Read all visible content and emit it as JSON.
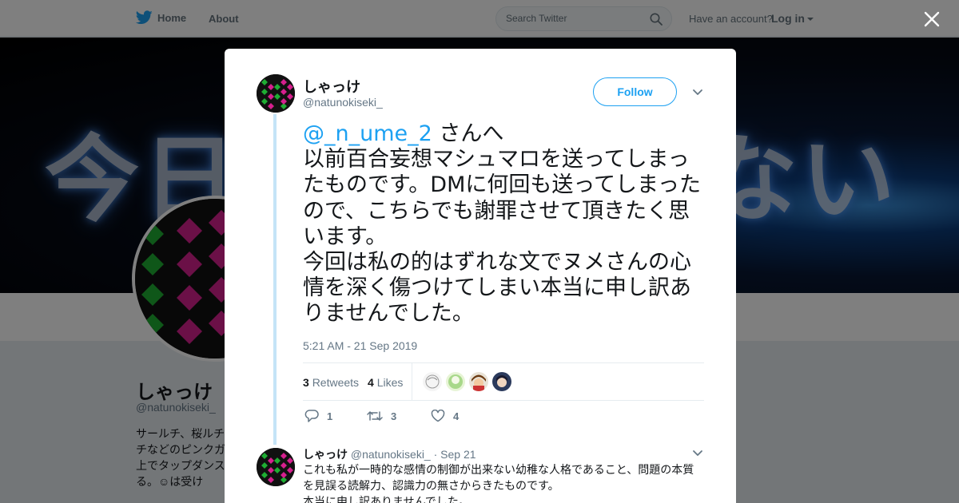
{
  "nav": {
    "home_label": "Home",
    "about_label": "About",
    "search_placeholder": "Search Twitter",
    "account_prompt": "Have an account?",
    "login_label": "Log in"
  },
  "banner": {
    "text_left": "今日",
    "text_right": "ない"
  },
  "profile": {
    "name": "しゃっけ",
    "handle": "@natunokiseki_",
    "bio": "サールチ、桜ルチ\nチなどのピンクガ\n上でタップダンス\nる。☺は受け"
  },
  "tweet": {
    "author_name": "しゃっけ",
    "author_handle": "@natunokiseki_",
    "follow_label": "Follow",
    "mention": "@_n_ume_2",
    "mention_suffix": " さんへ",
    "body": "以前百合妄想マシュマロを送ってしまったものです。DMに何回も送ってしまったので、こちらでも謝罪させて頂きたく思います。\n今回は私の的はずれな文でヌメさんの心情を深く傷つけてしまい本当に申し訳ありませんでした。",
    "timestamp": "5:21 AM - 21 Sep 2019",
    "retweets_count": "3",
    "retweets_label": "Retweets",
    "likes_count": "4",
    "likes_label": "Likes",
    "reply_count": "1",
    "retweet_action_count": "3",
    "like_action_count": "4"
  },
  "reply": {
    "author_name": "しゃっけ",
    "author_handle": "@natunokiseki_",
    "date": "· Sep 21",
    "text": "これも私が一時的な感情の制御が出来ない幼稚な人格であること、問題の本質を見誤る読解力、認識力の無さからきたものです。\n本当に申し訳ありませんでした。"
  },
  "colors": {
    "accent": "#1da1f2",
    "avatar_pink": "#d6208e",
    "avatar_green": "#1fae33"
  }
}
